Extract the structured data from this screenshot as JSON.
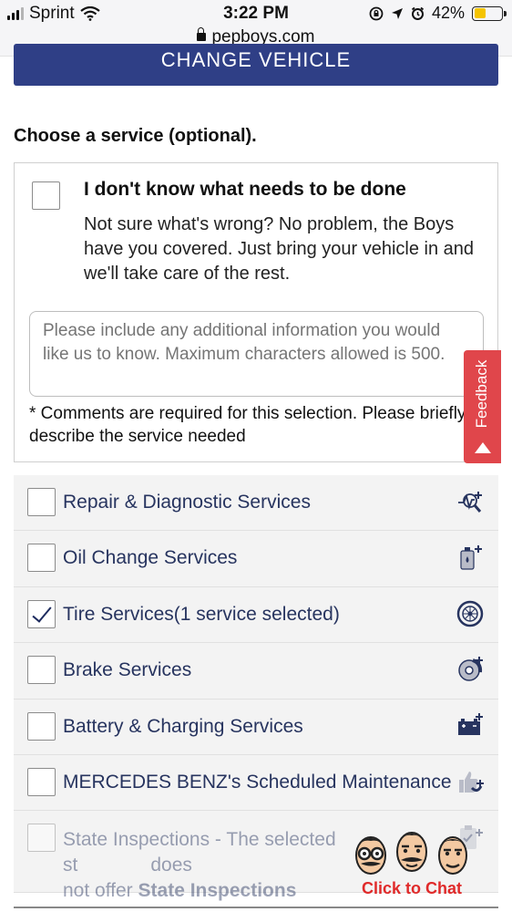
{
  "status_bar": {
    "carrier": "Sprint",
    "time": "3:22 PM",
    "battery": "42%",
    "battery_level": 0.42,
    "url": "pepboys.com"
  },
  "change_vehicle_label": "CHANGE VEHICLE",
  "section_title": "Choose a service (optional).",
  "unknown_option": {
    "title": "I don't know what needs to be done",
    "description": "Not sure what's wrong? No problem, the Boys have you covered. Just bring your vehicle in and we'll take care of the rest.",
    "placeholder": "Please include any additional information you would like us to know. Maximum characters allowed is 500.",
    "note": "* Comments are required for this selection. Please briefly describe the service needed"
  },
  "feedback_label": "Feedback",
  "services": [
    {
      "label": "Repair & Diagnostic Services",
      "checked": false,
      "icon": "diagnostic-icon"
    },
    {
      "label": "Oil Change Services",
      "checked": false,
      "icon": "oil-bottle-icon"
    },
    {
      "label": "Tire Services(1 service selected)",
      "checked": true,
      "icon": "tire-icon"
    },
    {
      "label": "Brake Services",
      "checked": false,
      "icon": "brake-icon"
    },
    {
      "label": "Battery & Charging Services",
      "checked": false,
      "icon": "battery-icon"
    },
    {
      "label": "MERCEDES BENZ's Scheduled Maintenance",
      "checked": false,
      "icon": "thumbs-up-icon"
    }
  ],
  "state_inspections": {
    "text_start": "State Inspections - The selected st",
    "text_end": "does",
    "line2_prefix": "not offer ",
    "line2_bold": "State Inspections",
    "icon": "clipboard-icon"
  },
  "chat": {
    "label": "Click to Chat"
  },
  "colors": {
    "navy": "#2f3f86",
    "label_blue": "#27345f",
    "feedback_red": "#e0464b",
    "chat_red": "#e02a2a"
  }
}
